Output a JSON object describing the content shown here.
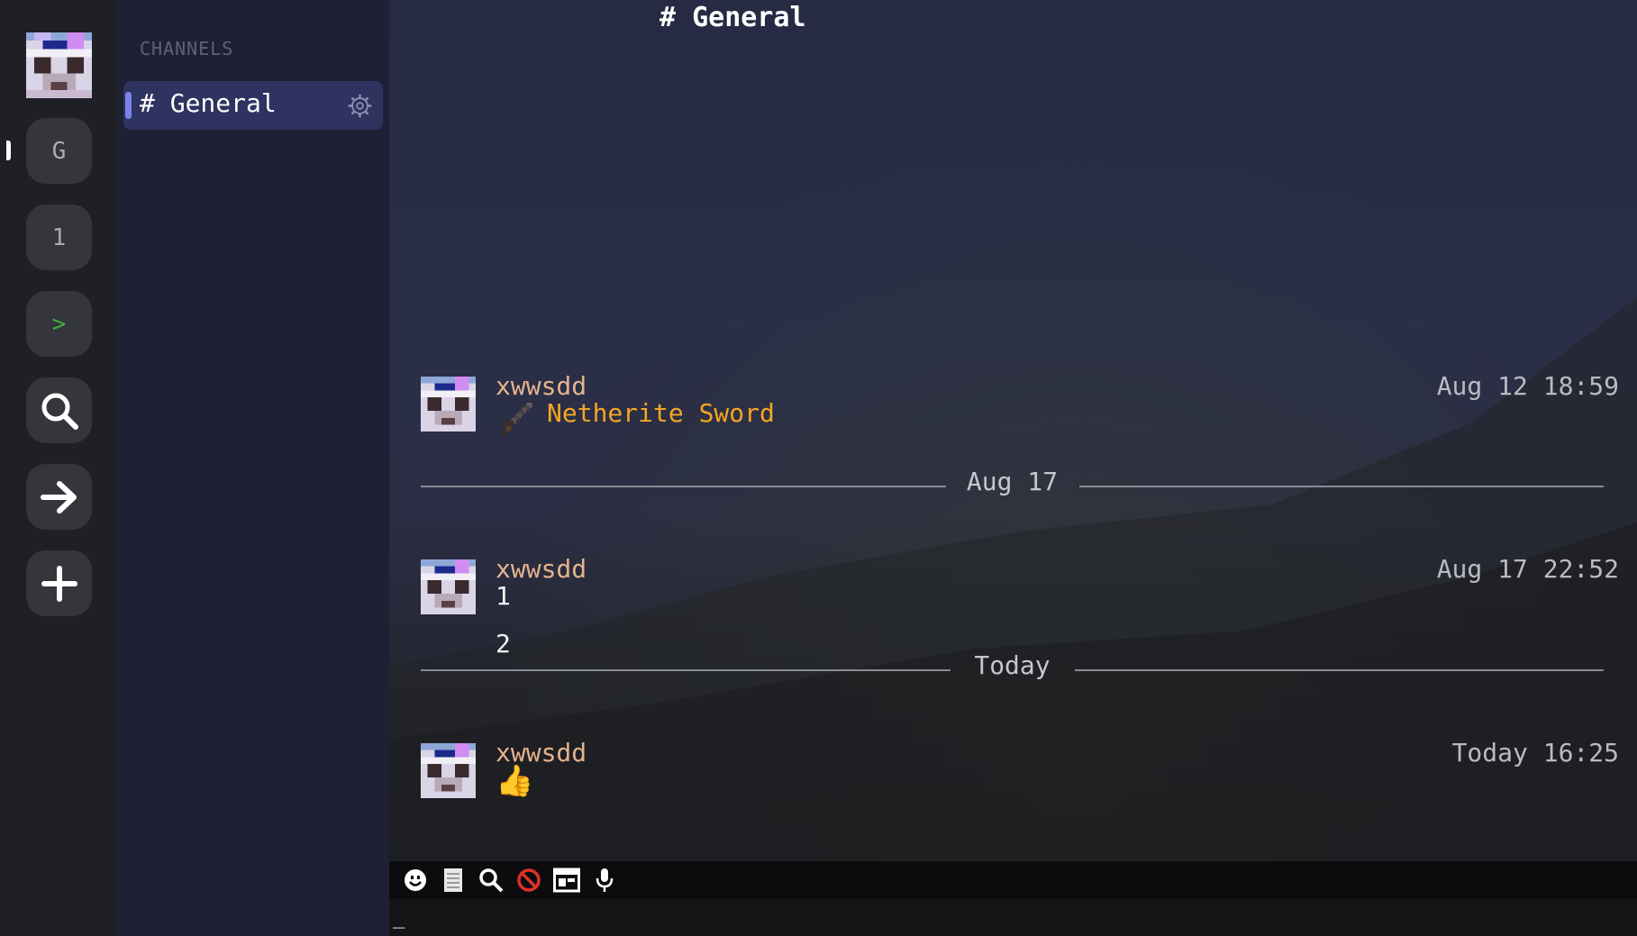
{
  "server_rail": {
    "items": [
      {
        "label": "G"
      },
      {
        "label": "1"
      },
      {
        "label": ">"
      }
    ]
  },
  "sidebar": {
    "header": "CHANNELS",
    "channels": [
      {
        "label": "# General",
        "selected": true
      }
    ]
  },
  "main": {
    "channel_title": "# General",
    "messages": [
      {
        "author": "xwwsdd",
        "time": "Aug 12 18:59",
        "lines": [
          "Netherite Sword"
        ],
        "item_icon": "netherite-sword-icon",
        "item_color": "#f5a623"
      },
      {
        "author": "xwwsdd",
        "time": "Aug 17 22:52",
        "lines": [
          "1",
          "2"
        ]
      },
      {
        "author": "xwwsdd",
        "time": "Today 16:25",
        "lines": [
          "👍"
        ]
      }
    ],
    "dividers": [
      "Aug 17",
      "Today"
    ]
  },
  "toolbar": {
    "tools": [
      "smiley-icon",
      "document-icon",
      "search-icon",
      "block-icon",
      "screenshot-icon",
      "microphone-icon"
    ]
  },
  "input": {
    "value": "_"
  },
  "colors": {
    "accent": "#7b83e8",
    "author": "#e3b48c",
    "item": "#f5a623",
    "block": "#e0302a"
  }
}
